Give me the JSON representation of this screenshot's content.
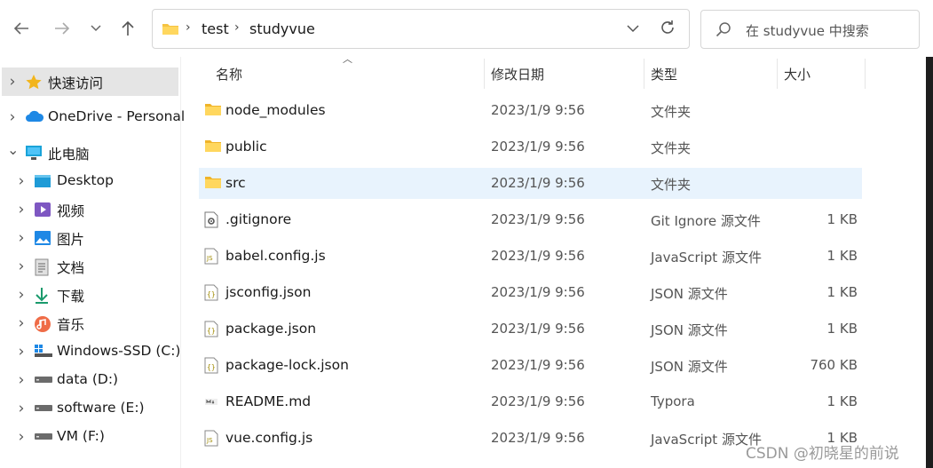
{
  "address": {
    "crumbs": [
      "test",
      "studyvue"
    ]
  },
  "search": {
    "placeholder": "在 studyvue 中搜索"
  },
  "sidebar": {
    "items": [
      {
        "label": "快速访问",
        "icon": "star-icon",
        "level": 0,
        "expanded": false,
        "selected": true
      },
      {
        "label": "OneDrive - Personal",
        "icon": "cloud-icon",
        "level": 0,
        "expanded": false,
        "selected": false
      },
      {
        "label": "此电脑",
        "icon": "monitor-icon",
        "level": 0,
        "expanded": true,
        "selected": false
      },
      {
        "label": "Desktop",
        "icon": "desktop-icon",
        "level": 1,
        "expanded": false,
        "selected": false
      },
      {
        "label": "视频",
        "icon": "video-icon",
        "level": 1,
        "expanded": false,
        "selected": false
      },
      {
        "label": "图片",
        "icon": "picture-icon",
        "level": 1,
        "expanded": false,
        "selected": false
      },
      {
        "label": "文档",
        "icon": "document-icon",
        "level": 1,
        "expanded": false,
        "selected": false
      },
      {
        "label": "下载",
        "icon": "download-icon",
        "level": 1,
        "expanded": false,
        "selected": false
      },
      {
        "label": "音乐",
        "icon": "music-icon",
        "level": 1,
        "expanded": false,
        "selected": false
      },
      {
        "label": "Windows-SSD (C:)",
        "icon": "windows-drive-icon",
        "level": 1,
        "expanded": false,
        "selected": false
      },
      {
        "label": "data (D:)",
        "icon": "drive-icon",
        "level": 1,
        "expanded": false,
        "selected": false
      },
      {
        "label": "software (E:)",
        "icon": "drive-icon",
        "level": 1,
        "expanded": false,
        "selected": false
      },
      {
        "label": "VM (F:)",
        "icon": "drive-icon",
        "level": 1,
        "expanded": false,
        "selected": false
      }
    ]
  },
  "columns": {
    "name": "名称",
    "date": "修改日期",
    "type": "类型",
    "size": "大小"
  },
  "files": [
    {
      "name": "node_modules",
      "date": "2023/1/9 9:56",
      "type": "文件夹",
      "size": "",
      "icon": "folder-icon",
      "highlight": false
    },
    {
      "name": "public",
      "date": "2023/1/9 9:56",
      "type": "文件夹",
      "size": "",
      "icon": "folder-icon",
      "highlight": false
    },
    {
      "name": "src",
      "date": "2023/1/9 9:56",
      "type": "文件夹",
      "size": "",
      "icon": "folder-icon",
      "highlight": true
    },
    {
      "name": ".gitignore",
      "date": "2023/1/9 9:56",
      "type": "Git Ignore 源文件",
      "size": "1 KB",
      "icon": "gear-file-icon",
      "highlight": false
    },
    {
      "name": "babel.config.js",
      "date": "2023/1/9 9:56",
      "type": "JavaScript 源文件",
      "size": "1 KB",
      "icon": "js-file-icon",
      "highlight": false
    },
    {
      "name": "jsconfig.json",
      "date": "2023/1/9 9:56",
      "type": "JSON 源文件",
      "size": "1 KB",
      "icon": "json-file-icon",
      "highlight": false
    },
    {
      "name": "package.json",
      "date": "2023/1/9 9:56",
      "type": "JSON 源文件",
      "size": "1 KB",
      "icon": "json-file-icon",
      "highlight": false
    },
    {
      "name": "package-lock.json",
      "date": "2023/1/9 9:56",
      "type": "JSON 源文件",
      "size": "760 KB",
      "icon": "json-file-icon",
      "highlight": false
    },
    {
      "name": "README.md",
      "date": "2023/1/9 9:56",
      "type": "Typora",
      "size": "1 KB",
      "icon": "markdown-file-icon",
      "highlight": false
    },
    {
      "name": "vue.config.js",
      "date": "2023/1/9 9:56",
      "type": "JavaScript 源文件",
      "size": "1 KB",
      "icon": "js-file-icon",
      "highlight": false
    }
  ],
  "watermark": "CSDN @初晓星的前说"
}
